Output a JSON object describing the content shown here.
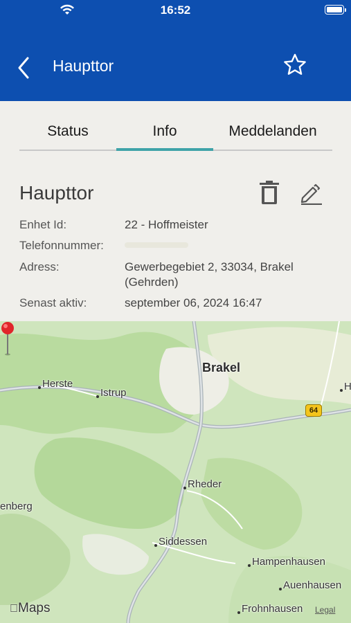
{
  "status_bar": {
    "time": "16:52"
  },
  "nav": {
    "title": "Haupttor",
    "back_icon": "chevron-left-icon",
    "favorite_icon": "star-outline-icon"
  },
  "tabs": [
    {
      "label": "Status",
      "active": false
    },
    {
      "label": "Info",
      "active": true
    },
    {
      "label": "Meddelanden",
      "active": false
    }
  ],
  "info": {
    "title": "Haupttor",
    "rows": [
      {
        "label": "Enhet Id:",
        "value": "22 - Hoffmeister"
      },
      {
        "label": "Telefonnummer:",
        "value": ""
      },
      {
        "label": "Adress:",
        "value_line1": "Gewerbegebiet 2, 33034, Brakel",
        "value_line2": "(Gehrden)"
      },
      {
        "label": "Senast aktiv:",
        "value": "september 06, 2024 16:47"
      }
    ]
  },
  "colors": {
    "header": "#0d4fb0",
    "tab_indicator": "#3fa3a8",
    "background": "#f0efeb",
    "pin": "#e0262b"
  },
  "map": {
    "labels": [
      "Brakel",
      "Herste",
      "Istrup",
      "Rheder",
      "enberg",
      "Siddessen",
      "Hampenhausen",
      "Auenhausen",
      "Frohnhausen",
      "H"
    ],
    "route_shield": "64",
    "brand": "Maps",
    "legal": "Legal"
  }
}
